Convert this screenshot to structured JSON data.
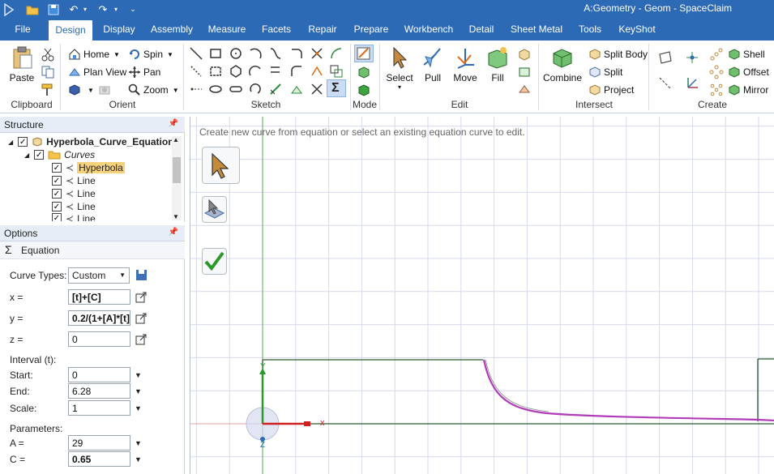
{
  "titlebar": {
    "title": "A:Geometry - Geom - SpaceClaim"
  },
  "tabs": [
    "File",
    "Design",
    "Display",
    "Assembly",
    "Measure",
    "Facets",
    "Repair",
    "Prepare",
    "Workbench",
    "Detail",
    "Sheet Metal",
    "Tools",
    "KeyShot"
  ],
  "active_tab": "Design",
  "ribbon": {
    "clipboard": {
      "paste": "Paste",
      "label": "Clipboard"
    },
    "orient": {
      "home": "Home",
      "spin": "Spin",
      "plan_view": "Plan View",
      "pan": "Pan",
      "zoom": "Zoom",
      "label": "Orient"
    },
    "sketch": {
      "label": "Sketch"
    },
    "mode": {
      "label": "Mode"
    },
    "edit": {
      "select": "Select",
      "pull": "Pull",
      "move": "Move",
      "fill": "Fill",
      "label": "Edit"
    },
    "intersect": {
      "combine": "Combine",
      "split_body": "Split Body",
      "split": "Split",
      "project": "Project",
      "label": "Intersect"
    },
    "create": {
      "shell": "Shell",
      "offset": "Offset",
      "mirror": "Mirror",
      "label": "Create"
    }
  },
  "structure": {
    "title": "Structure",
    "root": "Hyperbola_Curve_Equation",
    "folder": "Curves",
    "items": [
      "Hyperbola",
      "Line",
      "Line",
      "Line",
      "Line"
    ]
  },
  "options": {
    "title": "Options",
    "mode": "Equation",
    "curve_types_label": "Curve Types:",
    "curve_type": "Custom",
    "x_label": "x =",
    "x_value": "[t]+[C]",
    "y_label": "y =",
    "y_value": "0.2/(1+[A]*[t])",
    "z_label": "z =",
    "z_value": "0",
    "interval_label": "Interval (t):",
    "start_label": "Start:",
    "start_value": "0",
    "end_label": "End:",
    "end_value": "6.28",
    "scale_label": "Scale:",
    "scale_value": "1",
    "parameters_label": "Parameters:",
    "a_label": "A =",
    "a_value": "29",
    "c_label": "C =",
    "c_value": "0.65"
  },
  "viewport": {
    "hint": "Create new curve from equation or select an existing equation curve to edit.",
    "axis_x": "x",
    "axis_y": "Y",
    "axis_z": "Z"
  },
  "colors": {
    "accent": "#2d6ab5",
    "curve": "#b03cb8",
    "sketch_line": "#2b5a2b",
    "grid": "#d6d9f0"
  }
}
